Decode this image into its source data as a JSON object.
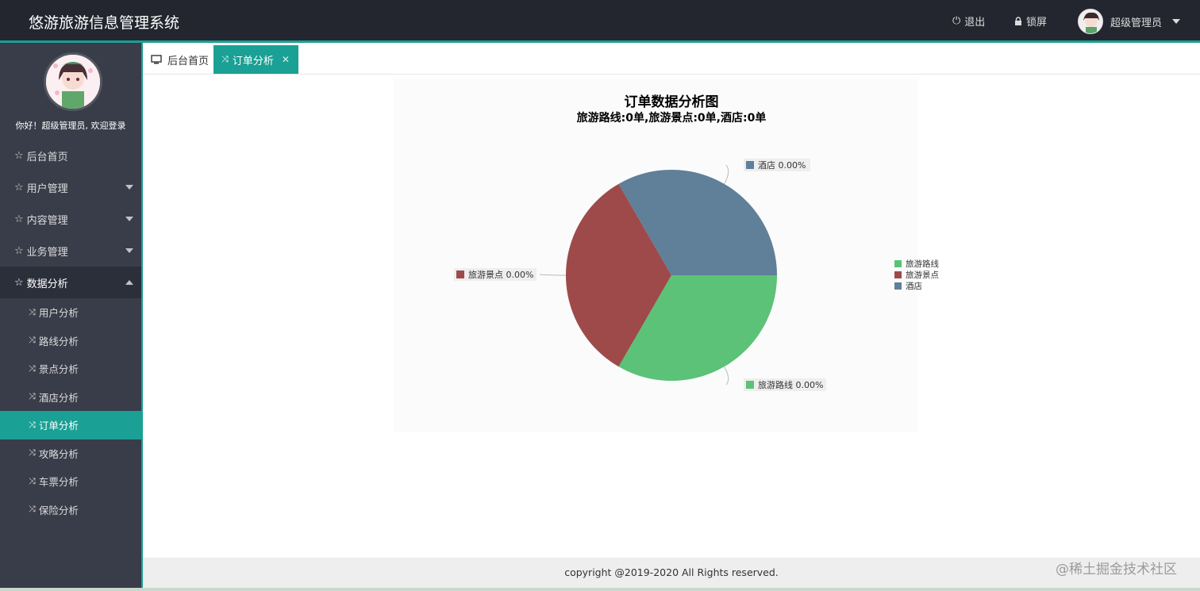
{
  "header": {
    "app_title": "悠游旅游信息管理系统",
    "logout_label": "退出",
    "lock_label": "锁屏",
    "user_name": "超级管理员"
  },
  "sidebar": {
    "welcome": "你好！超级管理员, 欢迎登录",
    "items": [
      {
        "label": "后台首页"
      },
      {
        "label": "用户管理"
      },
      {
        "label": "内容管理"
      },
      {
        "label": "业务管理"
      },
      {
        "label": "数据分析"
      }
    ],
    "sub_items": [
      {
        "label": "用户分析"
      },
      {
        "label": "路线分析"
      },
      {
        "label": "景点分析"
      },
      {
        "label": "酒店分析"
      },
      {
        "label": "订单分析"
      },
      {
        "label": "攻略分析"
      },
      {
        "label": "车票分析"
      },
      {
        "label": "保险分析"
      }
    ]
  },
  "tabs": [
    {
      "label": "后台首页"
    },
    {
      "label": "订单分析"
    }
  ],
  "footer": {
    "copyright": "copyright @2019-2020 All Rights reserved.",
    "watermark": "@稀土掘金技术社区"
  },
  "colors": {
    "accent": "#1aa094",
    "header_bg": "#23262e",
    "sidebar_bg": "#393d49",
    "series_route": "#5bc277",
    "series_scenic": "#9e4a4a",
    "series_hotel": "#607f98"
  },
  "chart_data": {
    "type": "pie",
    "title": "订单数据分析图",
    "subtitle": "旅游路线:0单,旅游景点:0单,酒店:0单",
    "legend_position": "right",
    "slices": [
      {
        "name": "旅游路线",
        "value": 0,
        "label": "旅游路线 0.00%",
        "color": "#5bc277"
      },
      {
        "name": "旅游景点",
        "value": 0,
        "label": "旅游景点 0.00%",
        "color": "#9e4a4a"
      },
      {
        "name": "酒店",
        "value": 0,
        "label": "酒店 0.00%",
        "color": "#607f98"
      }
    ]
  }
}
